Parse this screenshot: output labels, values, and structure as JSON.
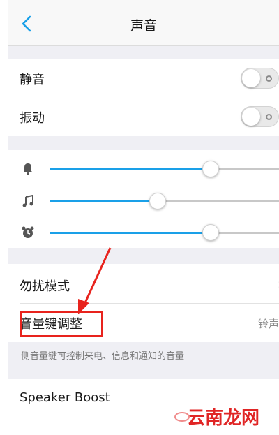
{
  "header": {
    "title": "声音",
    "back_icon": "chevron-left-icon"
  },
  "toggles": [
    {
      "label": "静音",
      "on": false
    },
    {
      "label": "振动",
      "on": false
    }
  ],
  "volume": [
    {
      "icon": "bell-icon",
      "level": 0.7
    },
    {
      "icon": "music-note-icon",
      "level": 0.47
    },
    {
      "icon": "alarm-clock-icon",
      "level": 0.7
    }
  ],
  "settings": [
    {
      "label": "勿扰模式",
      "chevron": "›"
    },
    {
      "label": "音量键调整",
      "value": "铃声"
    }
  ],
  "volume_key_description": "侧音量键可控制来电、信息和通知的音量",
  "speaker_boost": {
    "label": "Speaker Boost"
  },
  "watermark": {
    "text": "云南龙网"
  },
  "colors": {
    "accent": "#1aa0e8",
    "annotation": "#e8231d",
    "watermark": "#e02525"
  }
}
